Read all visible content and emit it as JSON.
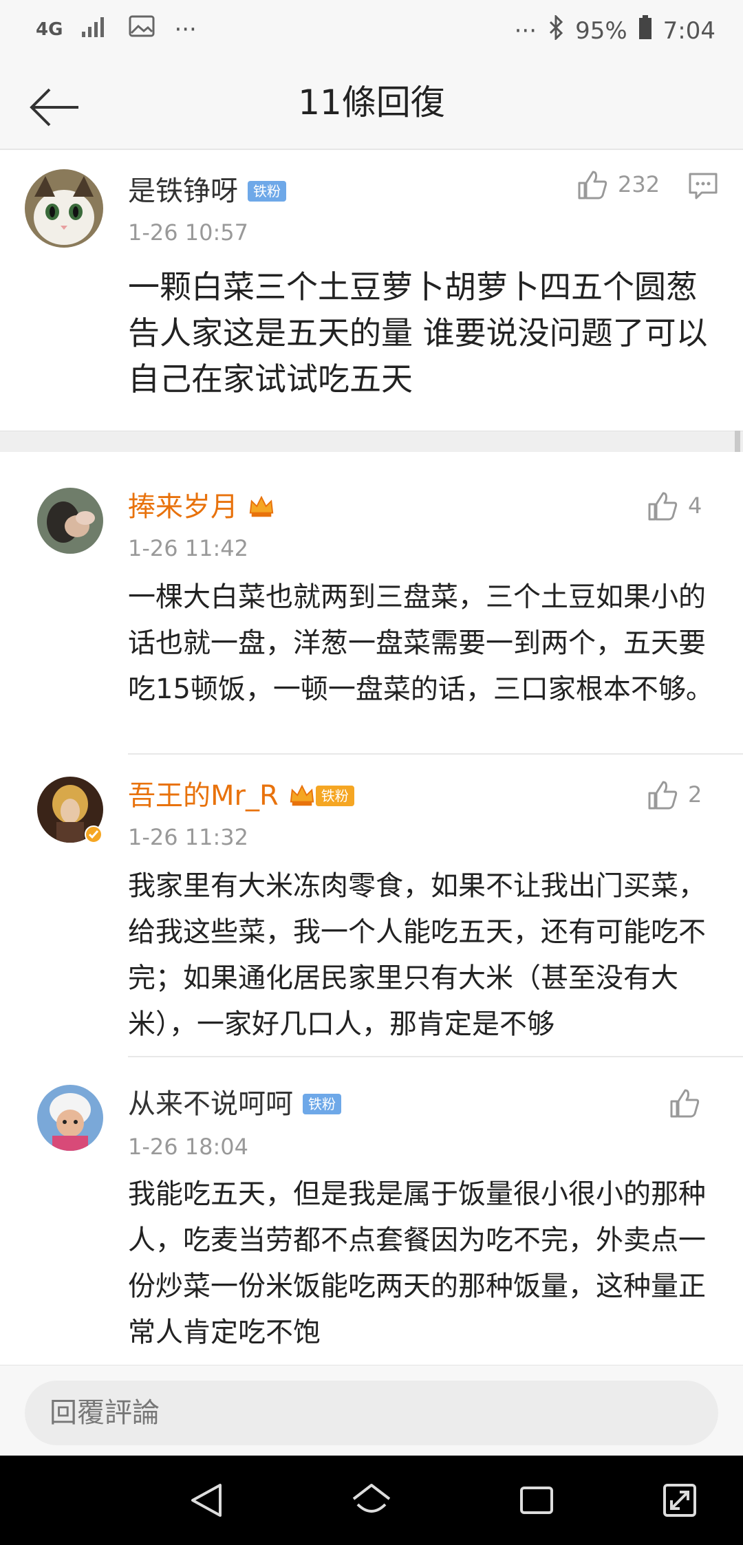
{
  "status_bar": {
    "network": "4G",
    "more": "···",
    "more_right": "···",
    "battery": "95%",
    "time": "7:04"
  },
  "header": {
    "title": "11條回復"
  },
  "main_comment": {
    "name": "是铁铮呀",
    "badge": "铁粉",
    "time": "1-26 10:57",
    "likes": "232",
    "content": "一颗白菜三个土豆萝卜胡萝卜四五个圆葱 告人家这是五天的量 谁要说没问题了可以自己在家试试吃五天"
  },
  "replies": [
    {
      "name": "捧来岁月",
      "time": "1-26 11:42",
      "likes": "4",
      "content": "一棵大白菜也就两到三盘菜，三个土豆如果小的话也就一盘，洋葱一盘菜需要一到两个，五天要吃15顿饭，一顿一盘菜的话，三口家根本不够。"
    },
    {
      "name": "吾王的Mr_R",
      "badge": "铁粉",
      "time": "1-26 11:32",
      "likes": "2",
      "content": "我家里有大米冻肉零食，如果不让我出门买菜，给我这些菜，我一个人能吃五天，还有可能吃不完；如果通化居民家里只有大米（甚至没有大米），一家好几口人，那肯定是不够"
    },
    {
      "name": "从来不说呵呵",
      "badge": "铁粉",
      "time": "1-26 18:04",
      "likes": "",
      "content": "我能吃五天，但是我是属于饭量很小很小的那种人，吃麦当劳都不点套餐因为吃不完，外卖点一份炒菜一份米饭能吃两天的那种饭量，这种量正常人肯定吃不饱"
    }
  ],
  "bottom": {
    "reply_placeholder": "回覆評論"
  },
  "colors": {
    "orange_name": "#e8720c",
    "badge_blue": "#6ea8e8",
    "badge_gold": "#f5a623"
  }
}
